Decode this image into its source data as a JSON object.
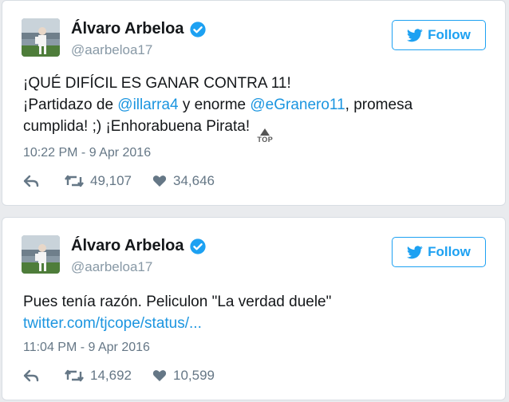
{
  "tweets": [
    {
      "author": {
        "name": "Álvaro Arbeloa",
        "handle": "@aarbeloa17",
        "verified": true
      },
      "follow_label": "Follow",
      "text": {
        "line1": "¡QUÉ DIFÍCIL ES GANAR CONTRA 11!",
        "line2_prefix": "¡Partidazo de ",
        "mention1": "@illarra4",
        "line2_mid": " y enorme ",
        "mention2": "@eGranero11",
        "line2_suffix": ", promesa",
        "line3": "cumplida! ;) ¡Enhorabuena Pirata! ",
        "emoji_text": "TOP"
      },
      "timestamp": "10:22 PM - 9 Apr 2016",
      "retweets": "49,107",
      "likes": "34,646"
    },
    {
      "author": {
        "name": "Álvaro Arbeloa",
        "handle": "@aarbeloa17",
        "verified": true
      },
      "follow_label": "Follow",
      "text": {
        "line1": "Pues tenía razón. Peliculon \"La verdad duele\"",
        "link": "twitter.com/tjcope/status/..."
      },
      "timestamp": "11:04 PM - 9 Apr 2016",
      "retweets": "14,692",
      "likes": "10,599"
    }
  ],
  "colors": {
    "accent": "#1da1f2",
    "link": "#1b95e0",
    "muted": "#657786",
    "handle": "#8899a6"
  },
  "icons": {
    "verified": "verified-badge-icon",
    "bird": "twitter-bird-icon",
    "reply": "reply-icon",
    "retweet": "retweet-icon",
    "like": "heart-icon"
  }
}
